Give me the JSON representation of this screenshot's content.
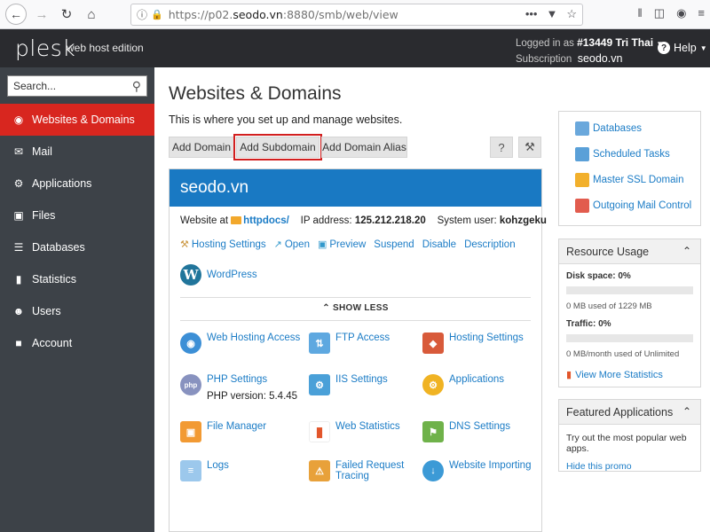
{
  "browser": {
    "url_prefix": "https://p02.",
    "url_domain": "seodo.vn",
    "url_suffix": ":8880/smb/web/view"
  },
  "header": {
    "logo": "plesk",
    "edition": "web host edition",
    "logged_in_label": "Logged in as",
    "logged_in_user": "#13449 Tri Thai",
    "subscription_label": "Subscription",
    "subscription_value": "seodo.vn",
    "help": "Help"
  },
  "sidebar": {
    "search_placeholder": "Search...",
    "items": [
      {
        "label": "Websites & Domains",
        "icon": "globe-icon"
      },
      {
        "label": "Mail",
        "icon": "mail-icon"
      },
      {
        "label": "Applications",
        "icon": "gear-icon"
      },
      {
        "label": "Files",
        "icon": "folder-icon"
      },
      {
        "label": "Databases",
        "icon": "database-icon"
      },
      {
        "label": "Statistics",
        "icon": "bar-chart-icon"
      },
      {
        "label": "Users",
        "icon": "user-icon"
      },
      {
        "label": "Account",
        "icon": "account-icon"
      }
    ]
  },
  "main": {
    "title": "Websites & Domains",
    "description": "This is where you set up and manage websites.",
    "buttons": {
      "add_domain": "Add Domain",
      "add_subdomain": "Add Subdomain",
      "add_alias": "Add Domain Alias",
      "help_tool": "?"
    }
  },
  "domain": {
    "name": "seodo.vn",
    "website_at_label": "Website at",
    "docroot": "httpdocs/",
    "ip_label": "IP address:",
    "ip": "125.212.218.20",
    "user_label": "System user:",
    "user": "kohzgeku",
    "actions": [
      "Hosting Settings",
      "Open",
      "Preview",
      "Suspend",
      "Disable",
      "Description"
    ],
    "wordpress": "WordPress",
    "show_less": "SHOW LESS",
    "tools": {
      "web_hosting_access": "Web Hosting Access",
      "ftp_access": "FTP Access",
      "hosting_settings": "Hosting Settings",
      "php_settings": "PHP Settings",
      "php_version": "PHP version: 5.4.45",
      "iis_settings": "IIS Settings",
      "applications": "Applications",
      "file_manager": "File Manager",
      "web_statistics": "Web Statistics",
      "dns_settings": "DNS Settings",
      "logs": "Logs",
      "failed_request_1": "Failed Request",
      "failed_request_2": "Tracing",
      "website_importing": "Website Importing"
    }
  },
  "right": {
    "links": [
      "Databases",
      "Scheduled Tasks",
      "Master SSL Domain",
      "Outgoing Mail Control"
    ],
    "usage_title": "Resource Usage",
    "disk_label": "Disk space: 0%",
    "disk_note": "0 MB used of 1229 MB",
    "disk_fraction": 0,
    "traffic_label": "Traffic: 0%",
    "traffic_note": "0 MB/month used of Unlimited",
    "traffic_fraction": 0,
    "stats_link": "View More Statistics",
    "featured_title": "Featured Applications",
    "featured_text": "Try out the most popular web apps.",
    "featured_hide": "Hide this promo"
  }
}
